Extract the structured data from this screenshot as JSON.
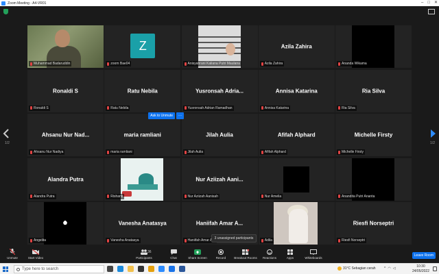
{
  "window": {
    "title": "Zoom Meeting - A4-VR01"
  },
  "gallery": {
    "page_left": "1/2",
    "page_right": "1/2",
    "tiles": [
      {
        "display": "",
        "label": "Muhammad Badaruddin",
        "kind": "video-person"
      },
      {
        "display": "Z",
        "label": "zoom Bae04",
        "kind": "avatar"
      },
      {
        "display": "",
        "label": "Anisyahrani Kaliana Putri Maulana",
        "kind": "balcony"
      },
      {
        "display": "Azila Zahira",
        "label": "Azila Zahira",
        "kind": "name"
      },
      {
        "display": "",
        "label": "Ananda Wikama",
        "kind": "black"
      },
      {
        "display": "Ronaldi S",
        "label": "Ronaldi S",
        "kind": "name"
      },
      {
        "display": "Ratu Nebila",
        "label": "Ratu Nebila",
        "kind": "name"
      },
      {
        "display": "Yusronsah Adria...",
        "label": "Yusronsah Adrian Ramadhan",
        "kind": "name"
      },
      {
        "display": "Annisa Katarina",
        "label": "Annisa Katarina",
        "kind": "name"
      },
      {
        "display": "Ria Silva",
        "label": "Ria Silva",
        "kind": "name"
      },
      {
        "display": "Ahsanu Nur Nad...",
        "label": "Ahsanu Nur Nadiya",
        "kind": "name"
      },
      {
        "display": "maria ramliani",
        "label": "maria ramliani",
        "kind": "name"
      },
      {
        "display": "Jilah Aulia",
        "label": "Jilah Aulia",
        "kind": "name"
      },
      {
        "display": "Afifah Alphard",
        "label": "Afifah Alphard",
        "kind": "name"
      },
      {
        "display": "Michelle Firsty",
        "label": "Michelle Firsty",
        "kind": "name"
      },
      {
        "display": "Alandra Putra",
        "label": "Alandra Putra",
        "kind": "name"
      },
      {
        "display": "",
        "label": "Rishanti",
        "kind": "mosque"
      },
      {
        "display": "Nur Aziizah Aani...",
        "label": "Nur Aziizah Aanisah",
        "kind": "name"
      },
      {
        "display": "",
        "label": "Nur Amelia",
        "kind": "black-small"
      },
      {
        "display": "",
        "label": "Anandita Putri Ananta",
        "kind": "black"
      },
      {
        "display": "",
        "label": "Angelita",
        "kind": "black-light"
      },
      {
        "display": "Vanesha Anatasya",
        "label": "Vanesha Anatasya",
        "kind": "name"
      },
      {
        "display": "Haniifah Amar A...",
        "label": "Haniifah Amar A...",
        "kind": "name"
      },
      {
        "display": "",
        "label": "Adila",
        "kind": "photo"
      },
      {
        "display": "Riesfi Norseptri",
        "label": "Riesfi Norseptri",
        "kind": "name"
      }
    ],
    "hover": {
      "add_label": "Ask to Unmute",
      "more_label": "···"
    },
    "unassigned": "3 unassigned participants"
  },
  "toolbar": {
    "unmute": "Unmute",
    "start_video": "Start Video",
    "participants": "Participants",
    "participants_count": "36",
    "chat": "Chat",
    "share": "Share Screen",
    "record": "Record",
    "breakout": "Breakout Rooms",
    "reactions": "Reactions",
    "apps": "Apps",
    "whiteboards": "Whiteboards",
    "leave": "Leave Room"
  },
  "taskbar": {
    "search_placeholder": "Type here to search",
    "weather": "31°C  Sebagian cerah",
    "time": "10:30",
    "date": "24/05/2022"
  },
  "colors": {
    "accent": "#0e72ed",
    "speaking": "#c6e23b",
    "muted": "#e04343",
    "share": "#23a05a"
  }
}
